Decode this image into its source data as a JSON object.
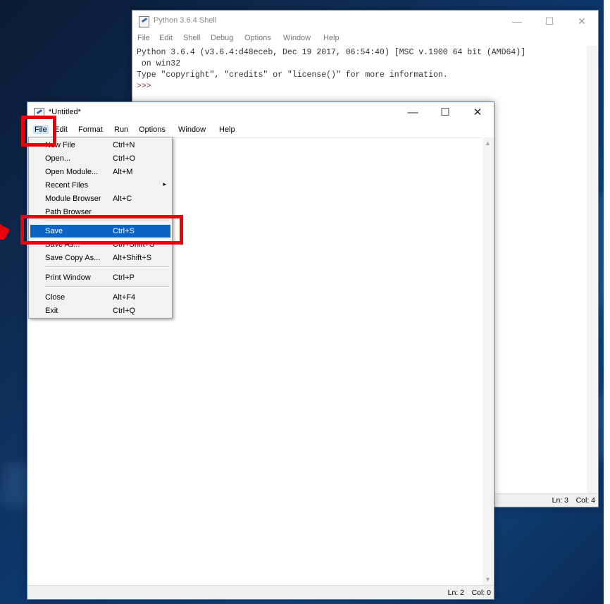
{
  "shell": {
    "title": "Python 3.6.4 Shell",
    "menu": [
      "File",
      "Edit",
      "Shell",
      "Debug",
      "Options",
      "Window",
      "Help"
    ],
    "lines": [
      "Python 3.6.4 (v3.6.4:d48eceb, Dec 19 2017, 06:54:40) [MSC v.1900 64 bit (AMD64)]",
      " on win32",
      "Type \"copyright\", \"credits\" or \"license()\" for more information."
    ],
    "prompt": ">>>",
    "status_ln": "Ln: 3",
    "status_col": "Col: 4"
  },
  "editor": {
    "title": "*Untitled*",
    "menu": {
      "file": "File",
      "edit": "Edit",
      "format": "Format",
      "run": "Run",
      "options": "Options",
      "window": "Window",
      "help": "Help"
    },
    "status_ln": "Ln: 2",
    "status_col": "Col: 0"
  },
  "file_menu": {
    "items": [
      {
        "label": "New File",
        "shortcut": "Ctrl+N"
      },
      {
        "label": "Open...",
        "shortcut": "Ctrl+O"
      },
      {
        "label": "Open Module...",
        "shortcut": "Alt+M"
      },
      {
        "label": "Recent Files",
        "shortcut": ""
      },
      {
        "label": "Module Browser",
        "shortcut": "Alt+C"
      },
      {
        "label": "Path Browser",
        "shortcut": ""
      },
      {
        "label": "Save",
        "shortcut": "Ctrl+S"
      },
      {
        "label": "Save As...",
        "shortcut": "Ctrl+Shift+S"
      },
      {
        "label": "Save Copy As...",
        "shortcut": "Alt+Shift+S"
      },
      {
        "label": "Print Window",
        "shortcut": "Ctrl+P"
      },
      {
        "label": "Close",
        "shortcut": "Alt+F4"
      },
      {
        "label": "Exit",
        "shortcut": "Ctrl+Q"
      }
    ],
    "highlighted_index": 6,
    "submenu_arrow": "▸"
  },
  "window_controls": {
    "minimize": "—",
    "maximize": "☐",
    "close": "✕"
  },
  "colors": {
    "highlight": "#0a64c8",
    "annotation_red": "#e8000b"
  },
  "icons": [
    "idle-file-icon",
    "minimize-icon",
    "maximize-icon",
    "close-icon",
    "submenu-arrow-icon"
  ]
}
